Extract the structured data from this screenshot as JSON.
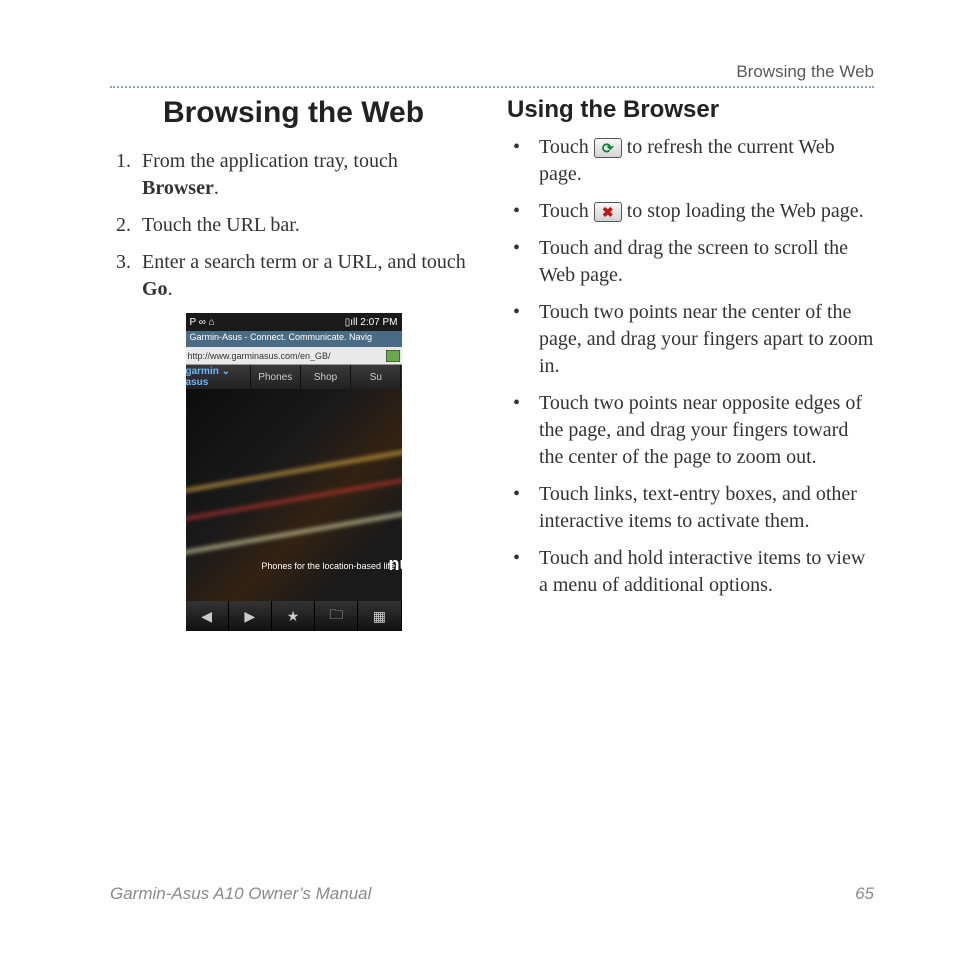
{
  "header": {
    "section": "Browsing the Web"
  },
  "left": {
    "title": "Browsing the Web",
    "steps": [
      {
        "pre": "From the application tray, touch ",
        "bold": "Browser",
        "post": "."
      },
      {
        "pre": "Touch the URL bar.",
        "bold": "",
        "post": ""
      },
      {
        "pre": "Enter a search term or a URL, and touch ",
        "bold": "Go",
        "post": "."
      }
    ]
  },
  "right": {
    "title": "Using the Browser",
    "bullets": {
      "b1_pre": "Touch ",
      "b1_post": " to refresh the current Web page.",
      "b2_pre": "Touch ",
      "b2_post": " to stop loading the Web page.",
      "b3": "Touch and drag the screen to scroll the Web page.",
      "b4": "Touch two points near the center of the page, and drag your fingers apart to zoom in.",
      "b5": "Touch two points near opposite edges of the page, and drag your fingers toward the center of the page to zoom out.",
      "b6": "Touch links, text-entry boxes, and other interactive items to activate them.",
      "b7": "Touch and hold interactive items to view a menu of additional options."
    }
  },
  "phone": {
    "status_left": "P ∞ ⌂",
    "status_right": "▯ıll  2:07 PM",
    "page_title": "Garmin-Asus - Connect. Communicate. Navig",
    "url": "http://www.garminasus.com/en_GB/",
    "logo": "garmin ⌄ asus",
    "tabs": [
      "Phones",
      "Shop",
      "Su"
    ],
    "banner_small": "Phones for the location-based life.",
    "banner_brand": "nüvi",
    "toolbar_icons": [
      "◀",
      "▶",
      "★",
      "🗀",
      "▦"
    ]
  },
  "footer": {
    "manual": "Garmin-Asus A10 Owner’s Manual",
    "page": "65"
  },
  "icons": {
    "refresh": "⟳",
    "stop": "✖"
  }
}
